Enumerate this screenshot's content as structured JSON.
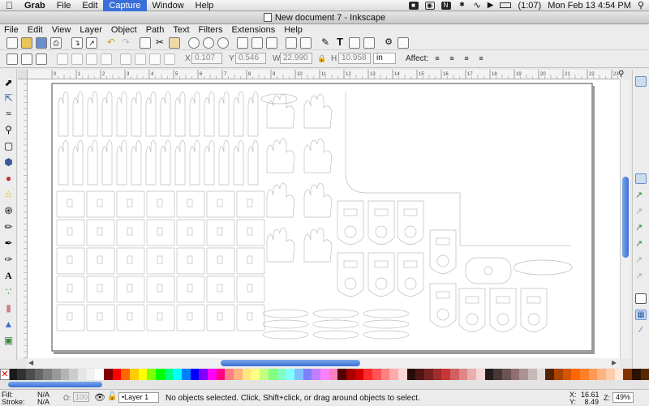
{
  "os_menubar": {
    "apple_icon": "apple-icon",
    "items": [
      {
        "label": "Grab",
        "bold": true
      },
      {
        "label": "File"
      },
      {
        "label": "Edit"
      },
      {
        "label": "Capture",
        "selected": true
      },
      {
        "label": "Window"
      },
      {
        "label": "Help"
      }
    ],
    "battery": "(1:07)",
    "clock": "Mon Feb 13  4:54 PM"
  },
  "window": {
    "title": "New document 7 - Inkscape"
  },
  "app_menu": [
    "File",
    "Edit",
    "View",
    "Layer",
    "Object",
    "Path",
    "Text",
    "Filters",
    "Extensions",
    "Help"
  ],
  "tool_controls": {
    "x_label": "X",
    "x_value": "0.107",
    "y_label": "Y",
    "y_value": "0.546",
    "w_label": "W",
    "w_value": "22.990",
    "h_label": "H",
    "h_value": "10.958",
    "unit": "in",
    "affect_label": "Affect:"
  },
  "ruler_labels": [
    "0",
    "1",
    "2",
    "3",
    "4",
    "5",
    "6",
    "7",
    "8",
    "9",
    "10",
    "11",
    "12",
    "13",
    "14",
    "15",
    "16",
    "17",
    "18",
    "19",
    "20",
    "21",
    "22",
    "23"
  ],
  "colors": {
    "accent": "#3b6fd8",
    "palette": [
      "#000000",
      "#1a1a1a",
      "#333333",
      "#4d4d4d",
      "#666666",
      "#808080",
      "#999999",
      "#b3b3b3",
      "#cccccc",
      "#e6e6e6",
      "#f2f2f2",
      "#ffffff",
      "#800000",
      "#ff0000",
      "#ff6600",
      "#ffcc00",
      "#ffff00",
      "#80ff00",
      "#00ff00",
      "#00ff80",
      "#00ffff",
      "#0080ff",
      "#0000ff",
      "#8000ff",
      "#ff00ff",
      "#ff0080",
      "#ff8080",
      "#ffb380",
      "#ffe680",
      "#ffff80",
      "#c0ff80",
      "#80ff80",
      "#80ffc0",
      "#80ffff",
      "#80c0ff",
      "#8080ff",
      "#c080ff",
      "#ff80ff",
      "#ff80c0",
      "#550000",
      "#aa0000",
      "#d40000",
      "#ff2a2a",
      "#ff5555",
      "#ff8080",
      "#ffaaaa",
      "#ffd5d5",
      "#280b0b",
      "#501616",
      "#782121",
      "#a02c2c",
      "#c83737",
      "#d35f5f",
      "#de8787",
      "#e9afaf",
      "#f4d7d7",
      "#241c1c",
      "#483737",
      "#6c5353",
      "#916f6f",
      "#ac9393",
      "#c8b7b7",
      "#e3dbdb",
      "#552200",
      "#aa4400",
      "#d45500",
      "#ff6600",
      "#ff7f2a",
      "#ff9955",
      "#ffb380",
      "#ffccaa",
      "#ffe6d5",
      "#803300",
      "#2b1100",
      "#552a00"
    ]
  },
  "status": {
    "fill_label": "Fill:",
    "fill_value": "N/A",
    "stroke_label": "Stroke:",
    "stroke_value": "N/A",
    "opacity_label": "O:",
    "opacity_value": "100",
    "layer": "•Layer 1",
    "message": "No objects selected. Click, Shift+click, or drag around objects to select.",
    "x_label": "X:",
    "x_value": "16.61",
    "y_label": "Y:",
    "y_value": "8.49",
    "zoom_label": "Z:",
    "zoom_value": "49%"
  }
}
